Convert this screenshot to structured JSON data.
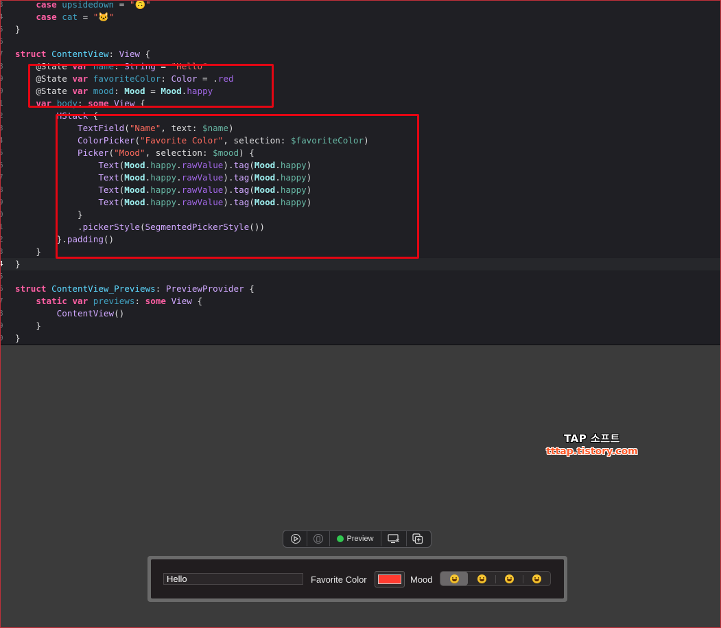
{
  "editor": {
    "lines": [
      {
        "num": "3",
        "tokens": [
          [
            "pl",
            "    "
          ],
          [
            "kw",
            "case"
          ],
          [
            "pl",
            " "
          ],
          [
            "id",
            "upsidedown"
          ],
          [
            "pl",
            " = "
          ],
          [
            "str",
            "\"🙃\""
          ]
        ]
      },
      {
        "num": "4",
        "tokens": [
          [
            "pl",
            "    "
          ],
          [
            "kw",
            "case"
          ],
          [
            "pl",
            " "
          ],
          [
            "id",
            "cat"
          ],
          [
            "pl",
            " = "
          ],
          [
            "str",
            "\"🐱\""
          ]
        ]
      },
      {
        "num": "5",
        "tokens": [
          [
            "pl",
            "}"
          ]
        ]
      },
      {
        "num": "6",
        "tokens": []
      },
      {
        "num": "7",
        "tokens": [
          [
            "kw",
            "struct"
          ],
          [
            "pl",
            " "
          ],
          [
            "ty",
            "ContentView"
          ],
          [
            "pl",
            ": "
          ],
          [
            "pty",
            "View"
          ],
          [
            "pl",
            " {"
          ]
        ]
      },
      {
        "num": "8",
        "tokens": [
          [
            "pl",
            "    "
          ],
          [
            "attr",
            "@State"
          ],
          [
            "pl",
            " "
          ],
          [
            "kw",
            "var"
          ],
          [
            "pl",
            " "
          ],
          [
            "id",
            "name"
          ],
          [
            "pl",
            ": "
          ],
          [
            "pty",
            "String"
          ],
          [
            "pl",
            " = "
          ],
          [
            "str",
            "\"Hello\""
          ]
        ]
      },
      {
        "num": "9",
        "tokens": [
          [
            "pl",
            "    "
          ],
          [
            "attr",
            "@State"
          ],
          [
            "pl",
            " "
          ],
          [
            "kw",
            "var"
          ],
          [
            "pl",
            " "
          ],
          [
            "id",
            "favoriteColor"
          ],
          [
            "pl",
            ": "
          ],
          [
            "pty",
            "Color"
          ],
          [
            "pl",
            " = ."
          ],
          [
            "mem",
            "red"
          ]
        ]
      },
      {
        "num": "0",
        "tokens": [
          [
            "pl",
            "    "
          ],
          [
            "attr",
            "@State"
          ],
          [
            "pl",
            " "
          ],
          [
            "kw",
            "var"
          ],
          [
            "pl",
            " "
          ],
          [
            "id",
            "mood"
          ],
          [
            "pl",
            ": "
          ],
          [
            "cur",
            "Mood"
          ],
          [
            "pl",
            " = "
          ],
          [
            "cur",
            "Mood"
          ],
          [
            "pl",
            "."
          ],
          [
            "mem",
            "happy"
          ]
        ]
      },
      {
        "num": "1",
        "tokens": [
          [
            "pl",
            "    "
          ],
          [
            "kw",
            "var"
          ],
          [
            "pl",
            " "
          ],
          [
            "id",
            "body"
          ],
          [
            "pl",
            ": "
          ],
          [
            "kw",
            "some"
          ],
          [
            "pl",
            " "
          ],
          [
            "pty",
            "View"
          ],
          [
            "pl",
            " {"
          ]
        ]
      },
      {
        "num": "2",
        "tokens": [
          [
            "pl",
            "        "
          ],
          [
            "pty",
            "HStack"
          ],
          [
            "pl",
            " {"
          ]
        ]
      },
      {
        "num": "3",
        "tokens": [
          [
            "pl",
            "            "
          ],
          [
            "pty",
            "TextField"
          ],
          [
            "pl",
            "("
          ],
          [
            "str",
            "\"Name\""
          ],
          [
            "pl",
            ", text: "
          ],
          [
            "lcl",
            "$name"
          ],
          [
            "pl",
            ")"
          ]
        ]
      },
      {
        "num": "4",
        "tokens": [
          [
            "pl",
            "            "
          ],
          [
            "pty",
            "ColorPicker"
          ],
          [
            "pl",
            "("
          ],
          [
            "str",
            "\"Favorite Color\""
          ],
          [
            "pl",
            ", selection: "
          ],
          [
            "lcl",
            "$favoriteColor"
          ],
          [
            "pl",
            ")"
          ]
        ]
      },
      {
        "num": "5",
        "tokens": [
          [
            "pl",
            "            "
          ],
          [
            "pty",
            "Picker"
          ],
          [
            "pl",
            "("
          ],
          [
            "str",
            "\"Mood\""
          ],
          [
            "pl",
            ", selection: "
          ],
          [
            "lcl",
            "$mood"
          ],
          [
            "pl",
            ") {"
          ]
        ]
      },
      {
        "num": "6",
        "tokens": [
          [
            "pl",
            "                "
          ],
          [
            "pty",
            "Text"
          ],
          [
            "pl",
            "("
          ],
          [
            "cur",
            "Mood"
          ],
          [
            "pl",
            "."
          ],
          [
            "lcl",
            "happy"
          ],
          [
            "pl",
            "."
          ],
          [
            "mem",
            "rawValue"
          ],
          [
            "pl",
            ")."
          ],
          [
            "fn",
            "tag"
          ],
          [
            "pl",
            "("
          ],
          [
            "cur",
            "Mood"
          ],
          [
            "pl",
            "."
          ],
          [
            "lcl",
            "happy"
          ],
          [
            "pl",
            ")"
          ]
        ]
      },
      {
        "num": "7",
        "tokens": [
          [
            "pl",
            "                "
          ],
          [
            "pty",
            "Text"
          ],
          [
            "pl",
            "("
          ],
          [
            "cur",
            "Mood"
          ],
          [
            "pl",
            "."
          ],
          [
            "lcl",
            "happy"
          ],
          [
            "pl",
            "."
          ],
          [
            "mem",
            "rawValue"
          ],
          [
            "pl",
            ")."
          ],
          [
            "fn",
            "tag"
          ],
          [
            "pl",
            "("
          ],
          [
            "cur",
            "Mood"
          ],
          [
            "pl",
            "."
          ],
          [
            "lcl",
            "happy"
          ],
          [
            "pl",
            ")"
          ]
        ]
      },
      {
        "num": "8",
        "tokens": [
          [
            "pl",
            "                "
          ],
          [
            "pty",
            "Text"
          ],
          [
            "pl",
            "("
          ],
          [
            "cur",
            "Mood"
          ],
          [
            "pl",
            "."
          ],
          [
            "lcl",
            "happy"
          ],
          [
            "pl",
            "."
          ],
          [
            "mem",
            "rawValue"
          ],
          [
            "pl",
            ")."
          ],
          [
            "fn",
            "tag"
          ],
          [
            "pl",
            "("
          ],
          [
            "cur",
            "Mood"
          ],
          [
            "pl",
            "."
          ],
          [
            "lcl",
            "happy"
          ],
          [
            "pl",
            ")"
          ]
        ]
      },
      {
        "num": "9",
        "tokens": [
          [
            "pl",
            "                "
          ],
          [
            "pty",
            "Text"
          ],
          [
            "pl",
            "("
          ],
          [
            "cur",
            "Mood"
          ],
          [
            "pl",
            "."
          ],
          [
            "lcl",
            "happy"
          ],
          [
            "pl",
            "."
          ],
          [
            "mem",
            "rawValue"
          ],
          [
            "pl",
            ")."
          ],
          [
            "fn",
            "tag"
          ],
          [
            "pl",
            "("
          ],
          [
            "cur",
            "Mood"
          ],
          [
            "pl",
            "."
          ],
          [
            "lcl",
            "happy"
          ],
          [
            "pl",
            ")"
          ]
        ]
      },
      {
        "num": "0",
        "tokens": [
          [
            "pl",
            "            }"
          ]
        ]
      },
      {
        "num": "1",
        "tokens": [
          [
            "pl",
            "            ."
          ],
          [
            "fn",
            "pickerStyle"
          ],
          [
            "pl",
            "("
          ],
          [
            "pty",
            "SegmentedPickerStyle"
          ],
          [
            "pl",
            "())"
          ]
        ]
      },
      {
        "num": "2",
        "tokens": [
          [
            "pl",
            "        }."
          ],
          [
            "fn",
            "padding"
          ],
          [
            "pl",
            "()"
          ]
        ]
      },
      {
        "num": "3",
        "tokens": [
          [
            "pl",
            "    }"
          ]
        ]
      },
      {
        "num": "4",
        "tokens": [
          [
            "pl",
            "}"
          ]
        ],
        "current": true
      },
      {
        "num": "5",
        "tokens": []
      },
      {
        "num": "6",
        "tokens": [
          [
            "kw",
            "struct"
          ],
          [
            "pl",
            " "
          ],
          [
            "ty",
            "ContentView_Previews"
          ],
          [
            "pl",
            ": "
          ],
          [
            "pty",
            "PreviewProvider"
          ],
          [
            "pl",
            " {"
          ]
        ]
      },
      {
        "num": "7",
        "tokens": [
          [
            "pl",
            "    "
          ],
          [
            "kw",
            "static"
          ],
          [
            "pl",
            " "
          ],
          [
            "kw",
            "var"
          ],
          [
            "pl",
            " "
          ],
          [
            "id",
            "previews"
          ],
          [
            "pl",
            ": "
          ],
          [
            "kw",
            "some"
          ],
          [
            "pl",
            " "
          ],
          [
            "pty",
            "View"
          ],
          [
            "pl",
            " {"
          ]
        ]
      },
      {
        "num": "8",
        "tokens": [
          [
            "pl",
            "        "
          ],
          [
            "pty",
            "ContentView"
          ],
          [
            "pl",
            "()"
          ]
        ]
      },
      {
        "num": "9",
        "tokens": [
          [
            "pl",
            "    }"
          ]
        ]
      },
      {
        "num": "0",
        "tokens": [
          [
            "pl",
            "}"
          ]
        ]
      }
    ]
  },
  "watermark": {
    "title": "TAP 소프트",
    "url": "tttap.tistory.com"
  },
  "preview_toolbar": {
    "live_icon": "play-circle-icon",
    "device_icon": "device-icon",
    "preview_label": "Preview",
    "status_color": "#31c750",
    "settings_icon": "device-settings-icon",
    "duplicate_icon": "duplicate-icon"
  },
  "preview": {
    "name_value": "Hello",
    "color_label": "Favorite Color",
    "color_value": "#ff3b30",
    "mood_label": "Mood",
    "mood_segments": [
      "😀",
      "😀",
      "😀",
      "😀"
    ],
    "mood_selected_index": 0
  }
}
